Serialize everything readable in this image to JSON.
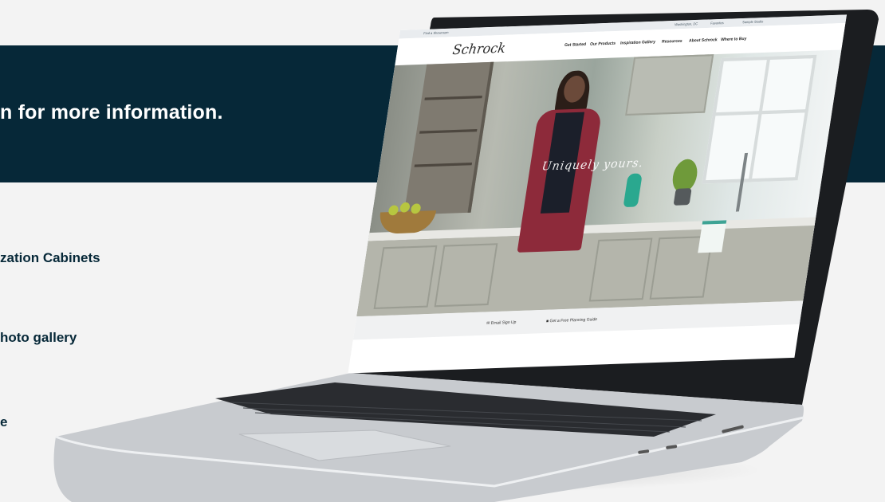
{
  "banner": {
    "text": "n for more information."
  },
  "links": [
    {
      "label": "zation Cabinets"
    },
    {
      "label": "hoto gallery"
    },
    {
      "label": "e"
    }
  ],
  "website": {
    "topbar_left": "Find a Showroom",
    "topbar_right_items": [
      "Washington, DC",
      "Favorites",
      "Sample Studio"
    ],
    "logo": "Schrock",
    "nav": [
      "Get Started",
      "Our Products",
      "Inspiration Gallery",
      "Resources",
      "About Schrock",
      "Where to Buy"
    ],
    "hero_tagline": "Uniquely yours.",
    "footer": {
      "email": "Email Sign Up",
      "guide": "Get a Free Planning Guide"
    }
  },
  "colors": {
    "banner_bg": "#062838",
    "link_text": "#062838",
    "page_bg": "#f3f3f3"
  }
}
